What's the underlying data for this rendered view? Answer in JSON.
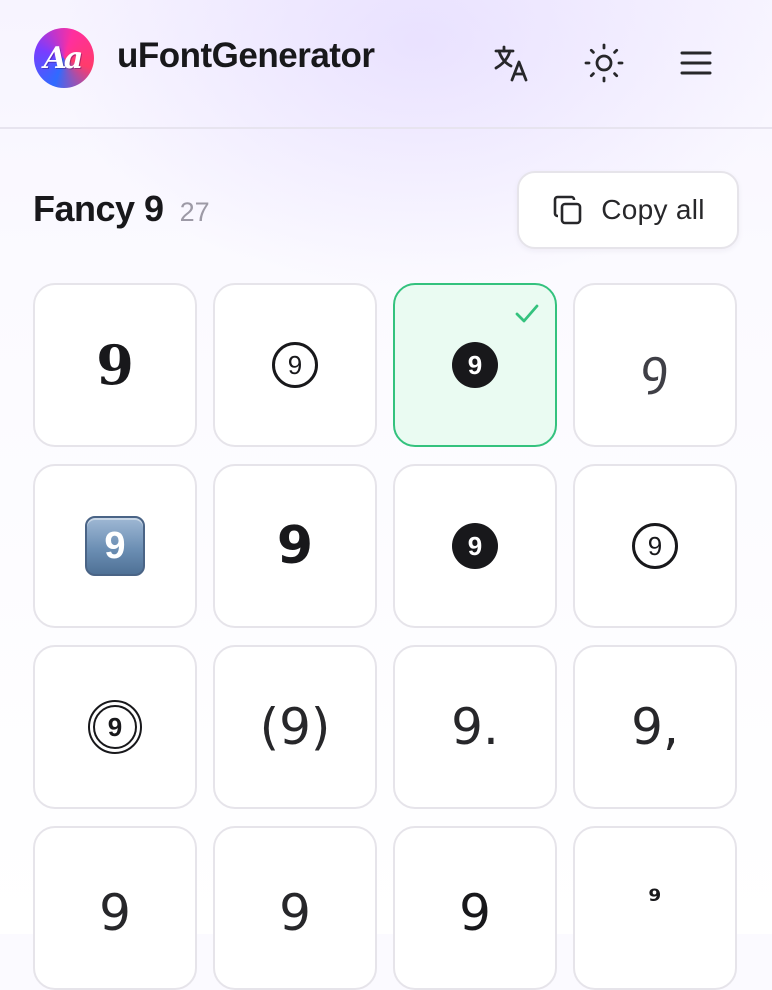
{
  "header": {
    "logo_text": "Aa",
    "brand": "uFontGenerator",
    "buttons": [
      {
        "name": "translate-button",
        "icon": "translate-icon"
      },
      {
        "name": "theme-toggle-button",
        "icon": "sun-icon"
      },
      {
        "name": "menu-button",
        "icon": "hamburger-menu-icon"
      }
    ]
  },
  "main": {
    "title": "Fancy 9",
    "count": "27",
    "copy_all_label": "Copy all"
  },
  "variants": [
    {
      "text": "𝟗",
      "style": "serifbold",
      "selected": false
    },
    {
      "text": "9",
      "style": "circ",
      "selected": false
    },
    {
      "text": "9",
      "style": "negcirc",
      "selected": true
    },
    {
      "text": "ꝯ",
      "style": "script",
      "selected": false
    },
    {
      "text": "9",
      "style": "keycap",
      "selected": false
    },
    {
      "text": "9",
      "style": "sansbold",
      "selected": false
    },
    {
      "text": "9",
      "style": "negcirc",
      "selected": false
    },
    {
      "text": "9",
      "style": "circ",
      "selected": false
    },
    {
      "text": "9",
      "style": "double",
      "selected": false
    },
    {
      "text": "(9)",
      "style": "light",
      "selected": false
    },
    {
      "text": "9.",
      "style": "light",
      "selected": false
    },
    {
      "text": "9,",
      "style": "light",
      "selected": false
    },
    {
      "text": "9",
      "style": "light",
      "selected": false
    },
    {
      "text": "9",
      "style": "light",
      "selected": false
    },
    {
      "text": "9",
      "style": "plain",
      "selected": false
    },
    {
      "text": "⁹",
      "style": "super",
      "selected": false
    }
  ],
  "colors": {
    "accent_green": "#34c27e",
    "selected_bg": "#eafbf2",
    "text": "#18181b",
    "muted": "#9d9aa6"
  }
}
